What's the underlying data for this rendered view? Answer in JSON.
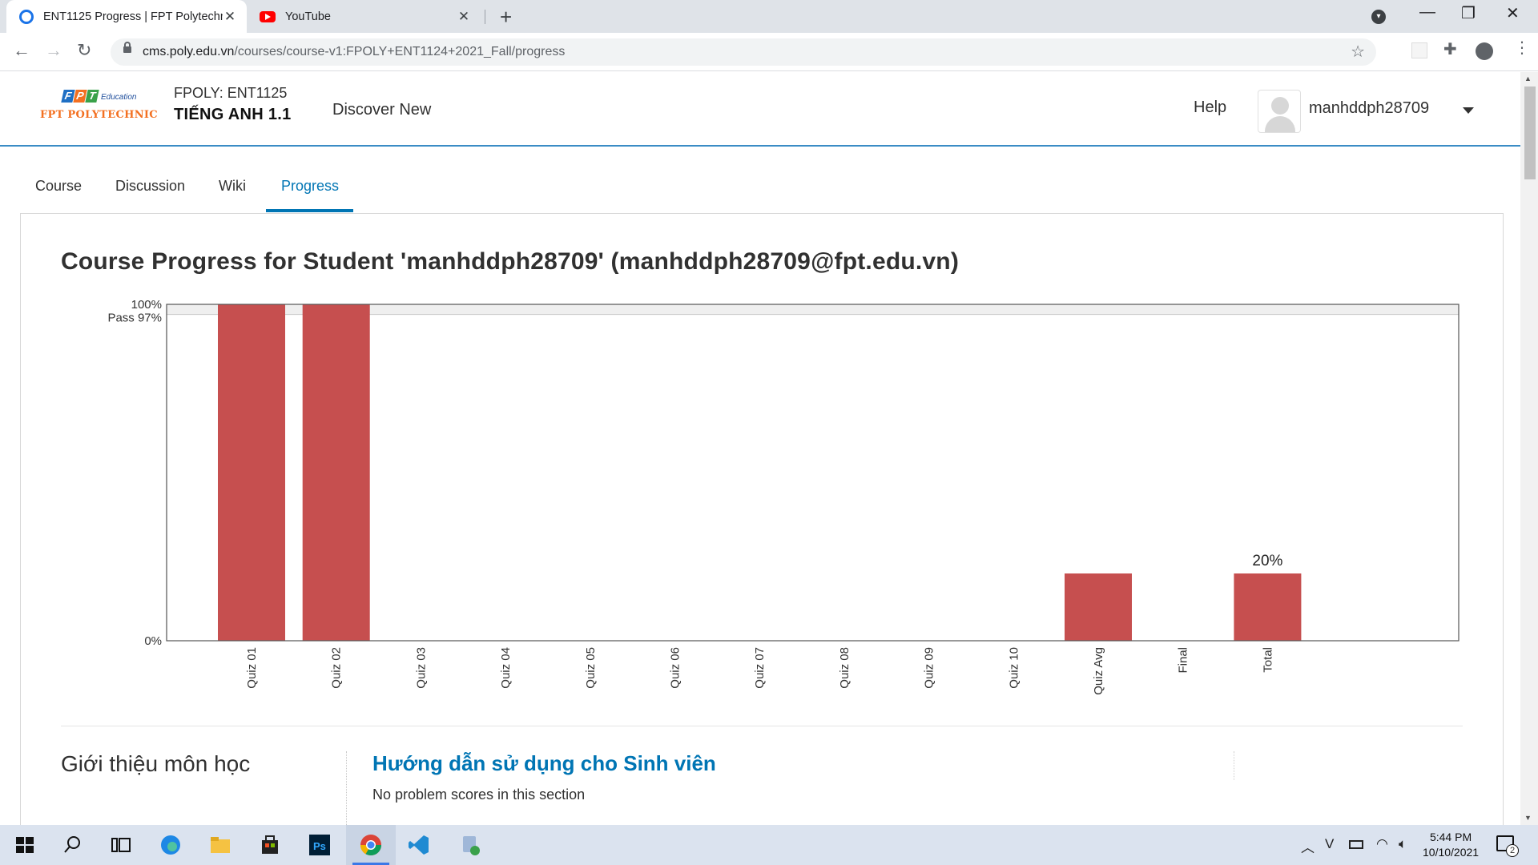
{
  "browser": {
    "tabs": [
      {
        "title": "ENT1125 Progress | FPT Polytechnic",
        "active": true,
        "favicon": "ring-favicon-icon"
      },
      {
        "title": "YouTube",
        "active": false,
        "favicon": "youtube-icon"
      }
    ],
    "url_host": "cms.poly.edu.vn",
    "url_path": "/courses/course-v1:FPOLY+ENT1124+2021_Fall/progress"
  },
  "header": {
    "logo_brand": "FPT",
    "logo_sub": "Education",
    "logo_name": "FPT POLYTECHNIC",
    "course_code": "FPOLY: ENT1125",
    "course_name": "TIẾNG ANH 1.1",
    "discover": "Discover New",
    "help": "Help",
    "username": "manhddph28709"
  },
  "tabs": [
    "Course",
    "Discussion",
    "Wiki",
    "Progress"
  ],
  "active_tab": "Progress",
  "page": {
    "title": "Course Progress for Student 'manhddph28709' (manhddph28709@fpt.edu.vn)"
  },
  "chart_data": {
    "type": "bar",
    "categories": [
      "Quiz 01",
      "Quiz 02",
      "Quiz 03",
      "Quiz 04",
      "Quiz 05",
      "Quiz 06",
      "Quiz 07",
      "Quiz 08",
      "Quiz 09",
      "Quiz 10",
      "Quiz Avg",
      "Final",
      "Total"
    ],
    "values": [
      100,
      100,
      0,
      0,
      0,
      0,
      0,
      0,
      0,
      0,
      20,
      0,
      20
    ],
    "value_labels": {
      "Total": "20%"
    },
    "ytick_labels": {
      "top": "100%",
      "pass": "Pass 97%",
      "bottom": "0%"
    },
    "pass_threshold": 97,
    "ylim": [
      0,
      100
    ],
    "bar_color": "#c64f4f",
    "grid": false
  },
  "section": {
    "left_title": "Giới thiệu môn học",
    "link": "Hướng dẫn sử dụng cho Sinh viên",
    "note": "No problem scores in this section"
  },
  "taskbar": {
    "time": "5:44 PM",
    "date": "10/10/2021",
    "notifications": "2"
  },
  "colors": {
    "accent": "#0075b4",
    "header_rule": "#3a8cc5",
    "logo_orange": "#f37021"
  }
}
